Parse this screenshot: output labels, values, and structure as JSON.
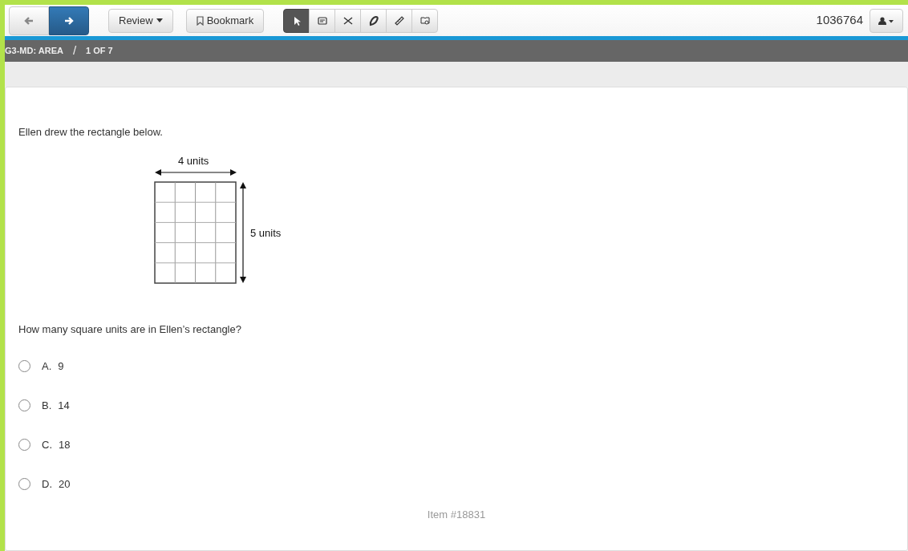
{
  "toolbar": {
    "nav": [
      {
        "kind": "back",
        "selected": false
      },
      {
        "kind": "next",
        "selected": true
      }
    ],
    "review": "Review",
    "bookmark": "Bookmark",
    "tools": [
      {
        "kind": "pointer",
        "selected": true
      },
      {
        "kind": "note",
        "selected": false
      },
      {
        "kind": "strike",
        "selected": false
      },
      {
        "kind": "highlight",
        "selected": false
      },
      {
        "kind": "ruler",
        "selected": false
      },
      {
        "kind": "glossary",
        "selected": false
      }
    ],
    "user_id": "1036764"
  },
  "breadcrumb": {
    "section": "G3-MD: AREA",
    "separator": "/",
    "position": "1 OF 7"
  },
  "question": {
    "stem": "Ellen drew the rectangle below.",
    "figure": {
      "width_label": "4 units",
      "height_label": "5 units"
    },
    "prompt": "How many square units are in Ellen’s rectangle?",
    "options": [
      {
        "letter": "A.",
        "text": "9",
        "selected": false
      },
      {
        "letter": "B.",
        "text": "14",
        "selected": false
      },
      {
        "letter": "C.",
        "text": "18",
        "selected": false
      },
      {
        "letter": "D.",
        "text": "20",
        "selected": false
      }
    ],
    "item_id": "Item #18831"
  }
}
